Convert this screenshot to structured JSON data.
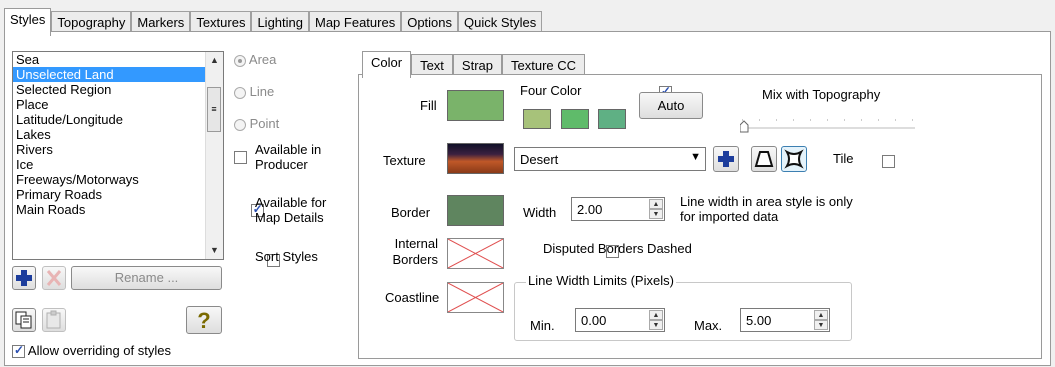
{
  "top_tabs": [
    "Styles",
    "Topography",
    "Markers",
    "Textures",
    "Lighting",
    "Map Features",
    "Options",
    "Quick Styles"
  ],
  "style_list": {
    "items": [
      "Sea",
      "Unselected Land",
      "Selected Region",
      "Place",
      "Latitude/Longitude",
      "Lakes",
      "Rivers",
      "Ice",
      "Freeways/Motorways",
      "Primary Roads",
      "Main Roads"
    ],
    "selected": "Unselected Land"
  },
  "geometry": {
    "area": "Area",
    "line": "Line",
    "point": "Point",
    "selected": "Area"
  },
  "options": {
    "available_in_producer": "Available in Producer",
    "available_in_producer_checked": false,
    "available_for_map_details": "Available for Map Details",
    "available_for_map_details_checked": true,
    "sort_styles": "Sort Styles",
    "sort_styles_checked": false
  },
  "list_buttons": {
    "rename": "Rename ...",
    "help": "?"
  },
  "allow_override": {
    "label": "Allow overriding of styles",
    "checked": true
  },
  "inner_tabs": [
    "Color",
    "Text",
    "Strap",
    "Texture CC"
  ],
  "color": {
    "fill_label": "Fill",
    "fill_color": "#7ab36a",
    "four_color_label": "Four Color",
    "four_color_checked": true,
    "four_colors": [
      "#a7c27a",
      "#5fbb6a",
      "#5fb084"
    ],
    "auto_label": "Auto",
    "mix_label": "Mix with Topography",
    "mix_value": 0,
    "texture_label": "Texture",
    "texture_value": "Desert",
    "tile_label": "Tile",
    "tile_checked": false,
    "border_label": "Border",
    "border_color": "#5f855f",
    "width_label": "Width",
    "width_value": "2.00",
    "width_note": "Line width in area style is only for imported data",
    "internal_borders_label": "Internal Borders",
    "disputed_label": "Disputed Borders Dashed",
    "disputed_checked": false,
    "coastline_label": "Coastline",
    "limits_title": "Line Width Limits (Pixels)",
    "min_label": "Min.",
    "min_value": "0.00",
    "max_label": "Max.",
    "max_value": "5.00"
  }
}
